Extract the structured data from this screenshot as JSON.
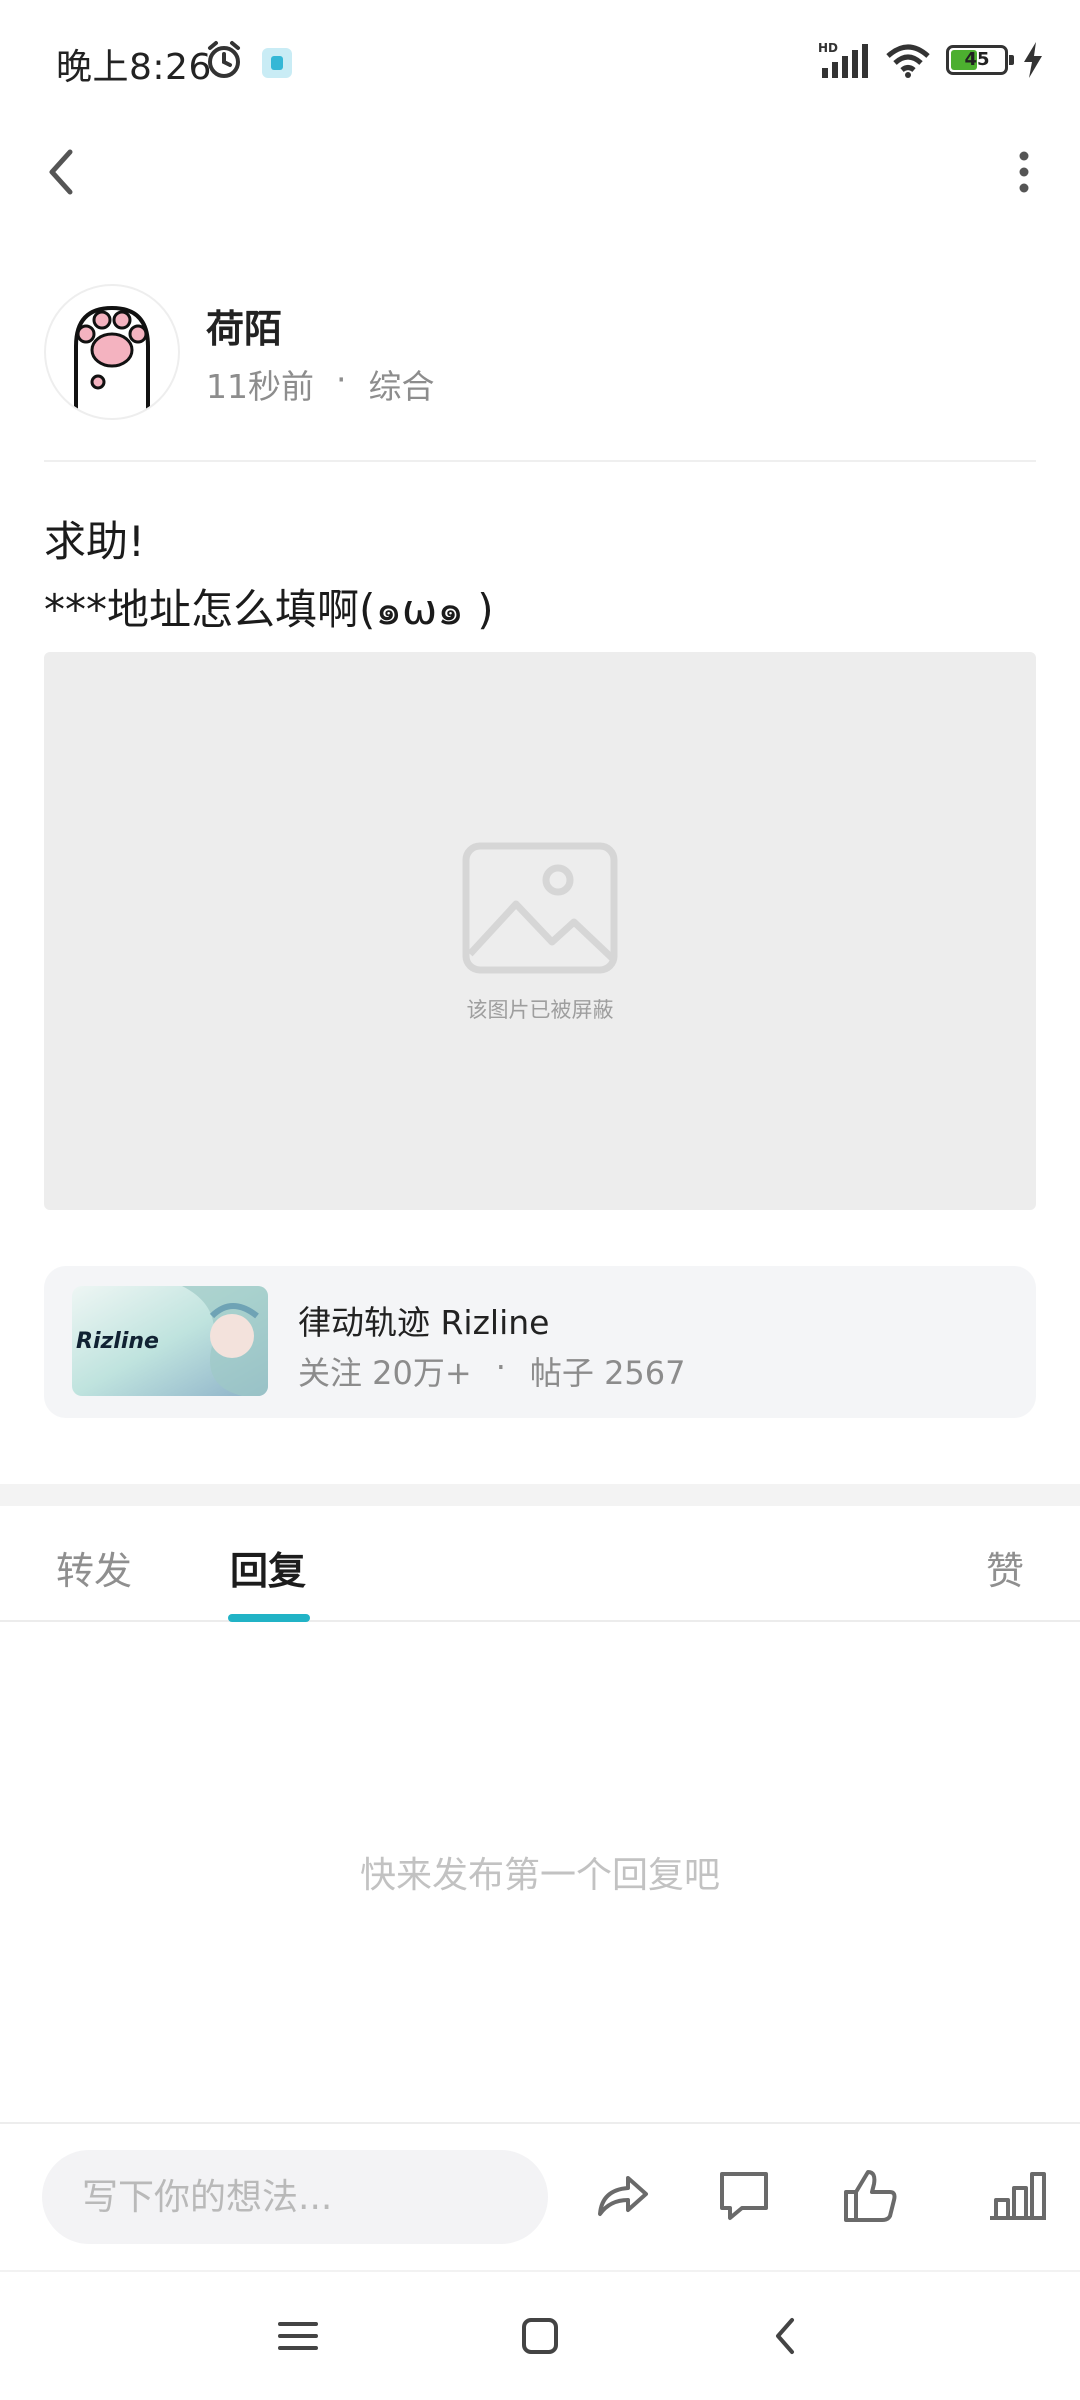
{
  "status_bar": {
    "time": "晚上8:26",
    "battery": "45",
    "network_badge": "HD"
  },
  "post": {
    "author": {
      "name": "荷陌",
      "time_ago": "11秒前",
      "separator": "·",
      "category": "综合"
    },
    "text": "求助!\n***地址怎么填啊(๑ω๑ )",
    "image": {
      "blocked_label": "该图片已被屏蔽"
    }
  },
  "forum_card": {
    "name": "律动轨迹 Rizline",
    "followers": "关注 20万+",
    "separator": "·",
    "posts": "帖子 2567",
    "logo_text": "Rizline"
  },
  "tabs": {
    "forward": "转发",
    "reply": "回复",
    "like": "赞",
    "active": "reply"
  },
  "replies": {
    "empty_hint": "快来发布第一个回复吧"
  },
  "bottom_bar": {
    "input_placeholder": "写下你的想法..."
  },
  "colors": {
    "accent": "#21b3c6",
    "blocked_bg": "#ededed",
    "card_bg": "#f4f5f7"
  },
  "icons": [
    "alarm-icon",
    "app-notification-icon",
    "signal-icon",
    "wifi-icon",
    "battery-icon",
    "charging-icon",
    "back-icon",
    "more-icon",
    "image-placeholder-icon",
    "share-icon",
    "comment-icon",
    "like-icon",
    "stats-icon",
    "menu-icon",
    "home-icon",
    "nav-back-icon"
  ]
}
